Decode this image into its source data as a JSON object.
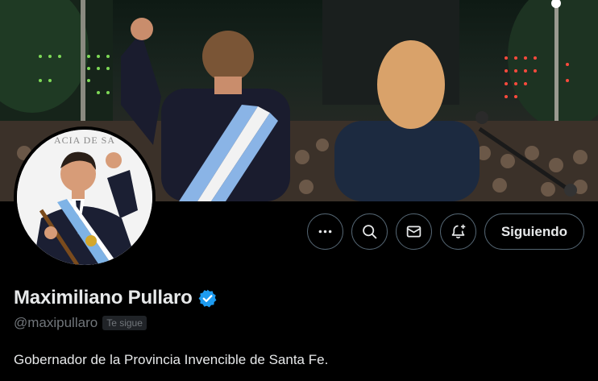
{
  "profile": {
    "display_name": "Maximiliano Pullaro",
    "handle": "@maxipullaro",
    "follows_you_badge": "Te sigue",
    "bio": "Gobernador de la Provincia Invencible de Santa Fe.",
    "verified": true
  },
  "avatar": {
    "sign_text": "ACIA DE SA"
  },
  "actions": {
    "more_icon": "more-icon",
    "search_icon": "search-icon",
    "message_icon": "envelope-icon",
    "notify_icon": "bell-plus-icon",
    "follow_label": "Siguiendo"
  },
  "colors": {
    "background": "#000000",
    "text_primary": "#e7e9ea",
    "text_secondary": "#71767b",
    "button_border": "#536471",
    "verified_blue": "#1d9bf0"
  }
}
